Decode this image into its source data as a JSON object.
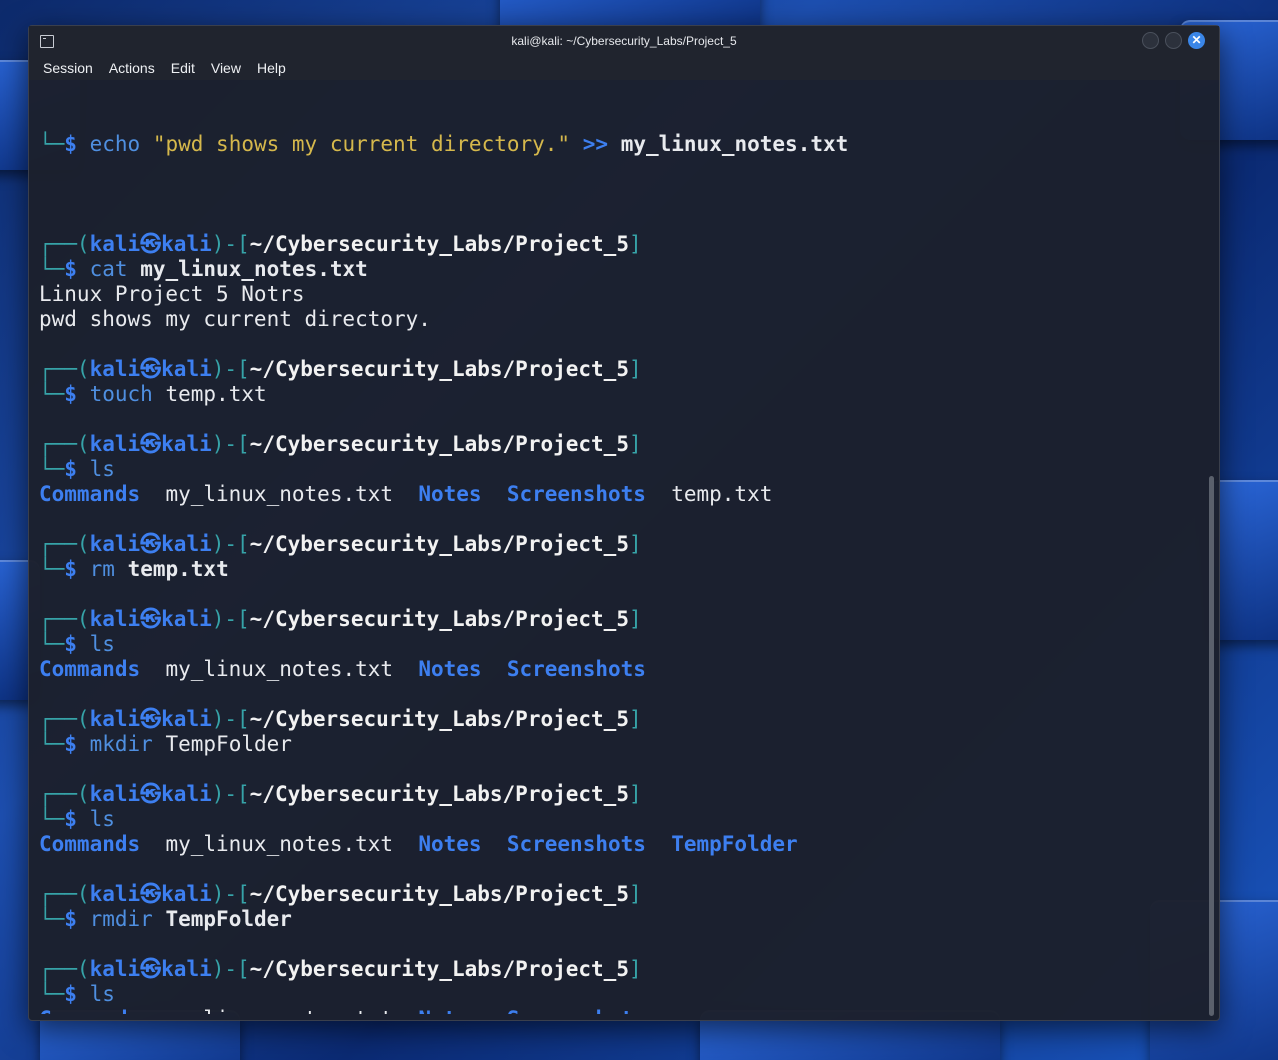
{
  "window": {
    "title": "kali@kali: ~/Cybersecurity_Labs/Project_5"
  },
  "menu": [
    "Session",
    "Actions",
    "Edit",
    "View",
    "Help"
  ],
  "prompt": {
    "user": "kali",
    "host": "kali",
    "path": "~/Cybersecurity_Labs/Project_5",
    "symbol": "$"
  },
  "terminal": {
    "partial_command": {
      "cmd": "echo",
      "string": "\"pwd shows my current directory.\"",
      "op": ">>",
      "arg": "my_linux_notes.txt"
    },
    "blocks": [
      {
        "cmd": "cat",
        "arg": "my_linux_notes.txt",
        "arg_bold": true,
        "output": [
          "Linux Project 5 Notrs",
          "pwd shows my current directory."
        ]
      },
      {
        "cmd": "touch",
        "arg": "temp.txt",
        "arg_bold": false
      },
      {
        "cmd": "ls",
        "ls": [
          {
            "name": "Commands",
            "dir": true
          },
          {
            "name": "my_linux_notes.txt",
            "dir": false
          },
          {
            "name": "Notes",
            "dir": true
          },
          {
            "name": "Screenshots",
            "dir": true
          },
          {
            "name": "temp.txt",
            "dir": false
          }
        ]
      },
      {
        "cmd": "rm",
        "arg": "temp.txt",
        "arg_bold": true
      },
      {
        "cmd": "ls",
        "ls": [
          {
            "name": "Commands",
            "dir": true
          },
          {
            "name": "my_linux_notes.txt",
            "dir": false
          },
          {
            "name": "Notes",
            "dir": true
          },
          {
            "name": "Screenshots",
            "dir": true
          }
        ]
      },
      {
        "cmd": "mkdir",
        "arg": "TempFolder",
        "arg_bold": false
      },
      {
        "cmd": "ls",
        "ls": [
          {
            "name": "Commands",
            "dir": true
          },
          {
            "name": "my_linux_notes.txt",
            "dir": false
          },
          {
            "name": "Notes",
            "dir": true
          },
          {
            "name": "Screenshots",
            "dir": true
          },
          {
            "name": "TempFolder",
            "dir": true
          }
        ]
      },
      {
        "cmd": "rmdir",
        "arg": "TempFolder",
        "arg_bold": true
      },
      {
        "cmd": "ls",
        "ls": [
          {
            "name": "Commands",
            "dir": true
          },
          {
            "name": "my_linux_notes.txt",
            "dir": false
          },
          {
            "name": "Notes",
            "dir": true
          },
          {
            "name": "Screenshots",
            "dir": true
          }
        ]
      },
      {
        "cmd": "",
        "cursor": true
      }
    ]
  },
  "colors": {
    "prompt_frame": "#36a3a8",
    "user_host": "#3d7ff0",
    "command": "#4f8fe0",
    "string": "#d5b84c",
    "directory": "#3d7ff0",
    "background": "#1c202c"
  }
}
